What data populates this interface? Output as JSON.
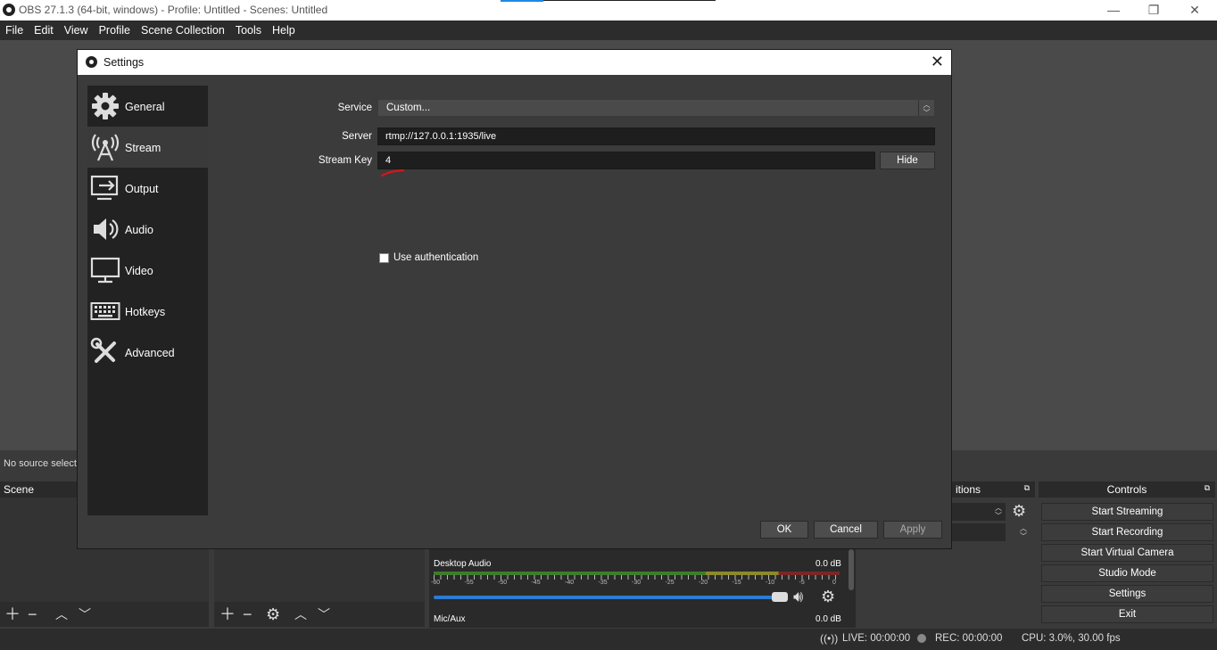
{
  "window": {
    "title": "OBS 27.1.3 (64-bit, windows) - Profile: Untitled - Scenes: Untitled",
    "minimize": "—",
    "restore": "❐",
    "close": "✕"
  },
  "menu": [
    "File",
    "Edit",
    "View",
    "Profile",
    "Scene Collection",
    "Tools",
    "Help"
  ],
  "background": {
    "no_source": "No source selecte",
    "scene_header": "Scene",
    "transitions_header": "itions",
    "controls_header": "Controls",
    "controls": [
      "Start Streaming",
      "Start Recording",
      "Start Virtual Camera",
      "Studio Mode",
      "Settings",
      "Exit"
    ],
    "mixer": {
      "desktop_label": "Desktop Audio",
      "desktop_db": "0.0 dB",
      "mic_label": "Mic/Aux",
      "mic_db": "0.0 dB",
      "ticks": [
        "-60",
        "-55",
        "-50",
        "-45",
        "-40",
        "-35",
        "-30",
        "-25",
        "-20",
        "-15",
        "-10",
        "-5",
        "0"
      ],
      "volume_fraction": 1.0
    },
    "status": {
      "live": "LIVE: 00:00:00",
      "rec": "REC: 00:00:00",
      "cpu": "CPU: 3.0%, 30.00 fps"
    }
  },
  "dialog": {
    "title": "Settings",
    "close": "✕",
    "sidebar": [
      {
        "label": "General",
        "icon": "gear-icon"
      },
      {
        "label": "Stream",
        "icon": "antenna-icon",
        "active": true
      },
      {
        "label": "Output",
        "icon": "output-icon"
      },
      {
        "label": "Audio",
        "icon": "speaker-icon"
      },
      {
        "label": "Video",
        "icon": "monitor-icon"
      },
      {
        "label": "Hotkeys",
        "icon": "keyboard-icon"
      },
      {
        "label": "Advanced",
        "icon": "tools-icon"
      }
    ],
    "stream": {
      "service_label": "Service",
      "service_value": "Custom...",
      "server_label": "Server",
      "server_value": "rtmp://127.0.0.1:1935/live",
      "key_label": "Stream Key",
      "key_value": "4",
      "hide_button": "Hide",
      "auth_label": "Use authentication",
      "auth_checked": false
    },
    "buttons": {
      "ok": "OK",
      "cancel": "Cancel",
      "apply": "Apply"
    }
  }
}
